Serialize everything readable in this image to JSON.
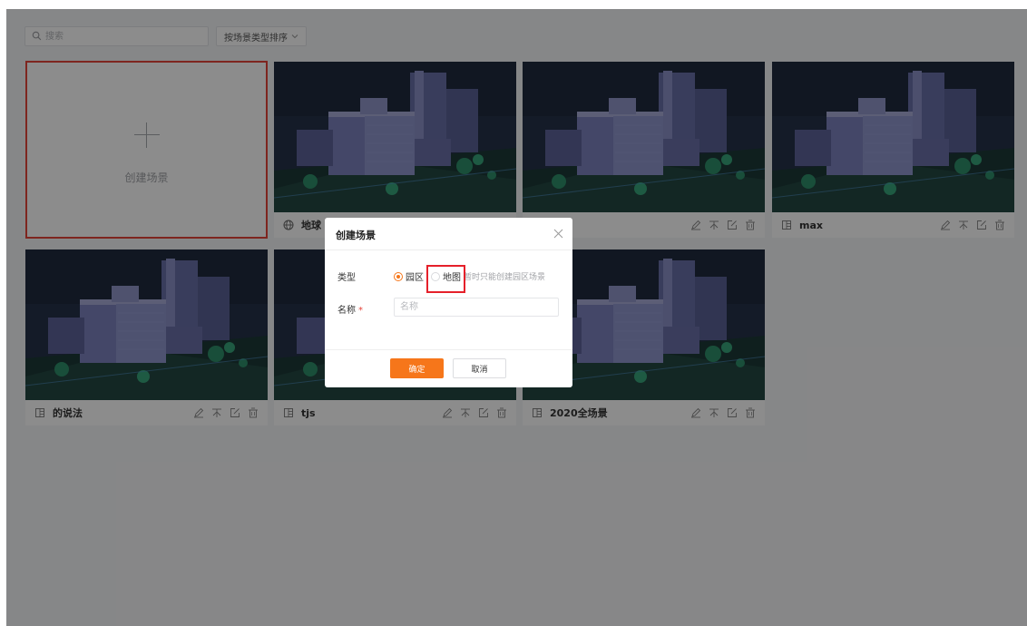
{
  "toolbar": {
    "search_placeholder": "搜索",
    "sort_label": "按场景类型排序"
  },
  "create_card": {
    "label": "创建场景"
  },
  "scenes": [
    {
      "name": "地球",
      "type_icon": "globe-icon"
    },
    {
      "name": "",
      "type_icon": "building-icon"
    },
    {
      "name": "max",
      "type_icon": "building-icon"
    },
    {
      "name": "的说法",
      "type_icon": "building-icon"
    },
    {
      "name": "tjs",
      "type_icon": "building-icon"
    },
    {
      "name": "2020全场景",
      "type_icon": "building-icon"
    }
  ],
  "card_actions": [
    "edit-icon",
    "pin-icon",
    "open-icon",
    "delete-icon"
  ],
  "dialog": {
    "title": "创建场景",
    "type_label": "类型",
    "type_options": [
      "园区",
      "地图"
    ],
    "type_selected": "园区",
    "type_hint": "暂时只能创建园区场景",
    "name_label": "名称",
    "required_mark": "*",
    "name_placeholder": "名称",
    "ok_label": "确定",
    "cancel_label": "取消"
  },
  "colors": {
    "accent": "#f6761a",
    "highlight": "#e5202a",
    "overlay": "rgba(0,0,0,0.45)"
  }
}
